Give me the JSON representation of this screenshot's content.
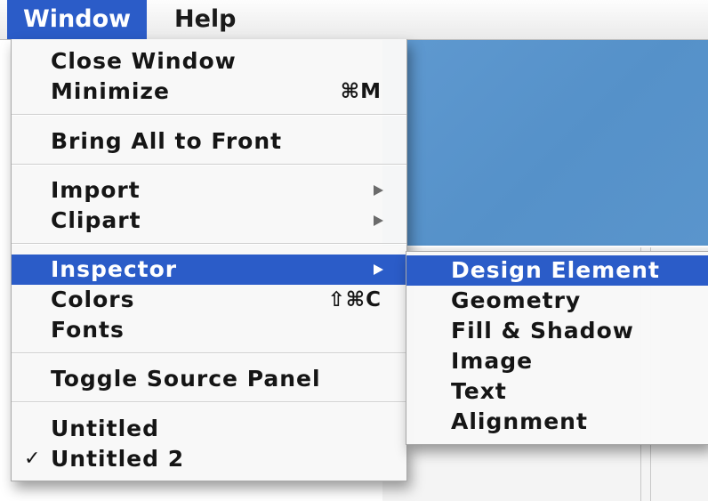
{
  "menubar": {
    "items": [
      {
        "label": "Window",
        "active": true
      },
      {
        "label": "Help",
        "active": false
      }
    ]
  },
  "window_menu": {
    "items": [
      {
        "label": "Close Window"
      },
      {
        "label": "Minimize",
        "shortcut": "⌘M"
      },
      {
        "label": "Bring All to Front"
      },
      {
        "label": "Import",
        "submenu": true
      },
      {
        "label": "Clipart",
        "submenu": true
      },
      {
        "label": "Inspector",
        "submenu": true,
        "highlighted": true
      },
      {
        "label": "Colors",
        "shortcut": "⇧⌘C"
      },
      {
        "label": "Fonts"
      },
      {
        "label": "Toggle Source Panel"
      },
      {
        "label": "Untitled"
      },
      {
        "label": "Untitled 2",
        "checked": true,
        "check_mark": "✓"
      }
    ]
  },
  "inspector_submenu": {
    "items": [
      {
        "label": "Design Element",
        "highlighted": true
      },
      {
        "label": "Geometry"
      },
      {
        "label": "Fill & Shadow"
      },
      {
        "label": "Image"
      },
      {
        "label": "Text"
      },
      {
        "label": "Alignment"
      }
    ]
  },
  "colors": {
    "highlight": "#2b5cc8",
    "canvas_blue": "#5a95cc"
  }
}
